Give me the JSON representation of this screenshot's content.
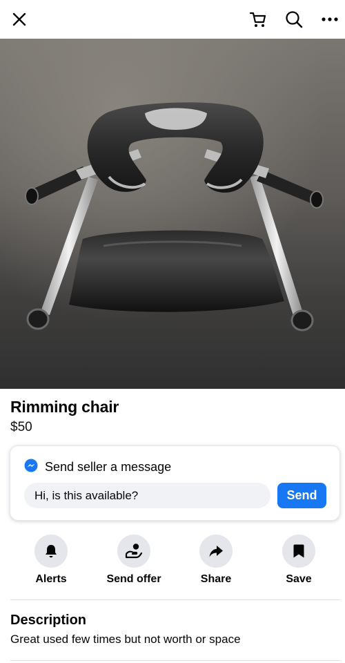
{
  "topbar": {
    "close_icon": "close-icon",
    "cart_icon": "cart-icon",
    "search_icon": "search-icon",
    "more_icon": "more-icon"
  },
  "listing": {
    "title": "Rimming chair",
    "price": "$50"
  },
  "message": {
    "header": "Send seller a message",
    "input_value": "Hi, is this available?",
    "send_label": "Send",
    "accent": "#1877f2"
  },
  "actions": [
    {
      "label": "Alerts",
      "icon": "bell-icon"
    },
    {
      "label": "Send offer",
      "icon": "offer-icon"
    },
    {
      "label": "Share",
      "icon": "share-icon"
    },
    {
      "label": "Save",
      "icon": "bookmark-icon"
    }
  ],
  "description": {
    "title": "Description",
    "text": "Great used few times but not worth or space"
  }
}
